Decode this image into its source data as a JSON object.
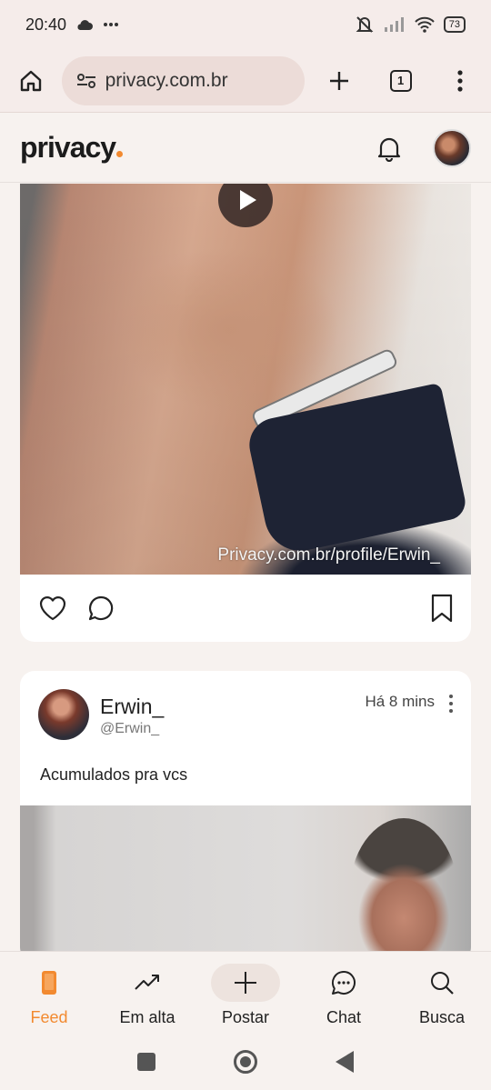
{
  "status_bar": {
    "time": "20:40",
    "battery": "73",
    "icons": [
      "cloud-icon",
      "more-dots-icon",
      "mute-icon",
      "signal-icon",
      "wifi-icon",
      "battery-icon"
    ]
  },
  "browser": {
    "url": "privacy.com.br",
    "tab_count": "1"
  },
  "header": {
    "logo": "privacy",
    "accent_color": "#f28a30"
  },
  "feed": {
    "post1": {
      "watermark": "Privacy.com.br/profile/Erwin_"
    },
    "post2": {
      "author": "Erwin_",
      "handle": "@Erwin_",
      "time": "Há 8 mins",
      "caption": "Acumulados pra vcs"
    }
  },
  "bottom_nav": {
    "items": [
      {
        "label": "Feed",
        "icon": "phone-icon",
        "active": true
      },
      {
        "label": "Em alta",
        "icon": "trending-icon",
        "active": false
      },
      {
        "label": "Postar",
        "icon": "plus-icon",
        "active": false
      },
      {
        "label": "Chat",
        "icon": "chat-icon",
        "active": false
      },
      {
        "label": "Busca",
        "icon": "search-icon",
        "active": false
      }
    ]
  }
}
